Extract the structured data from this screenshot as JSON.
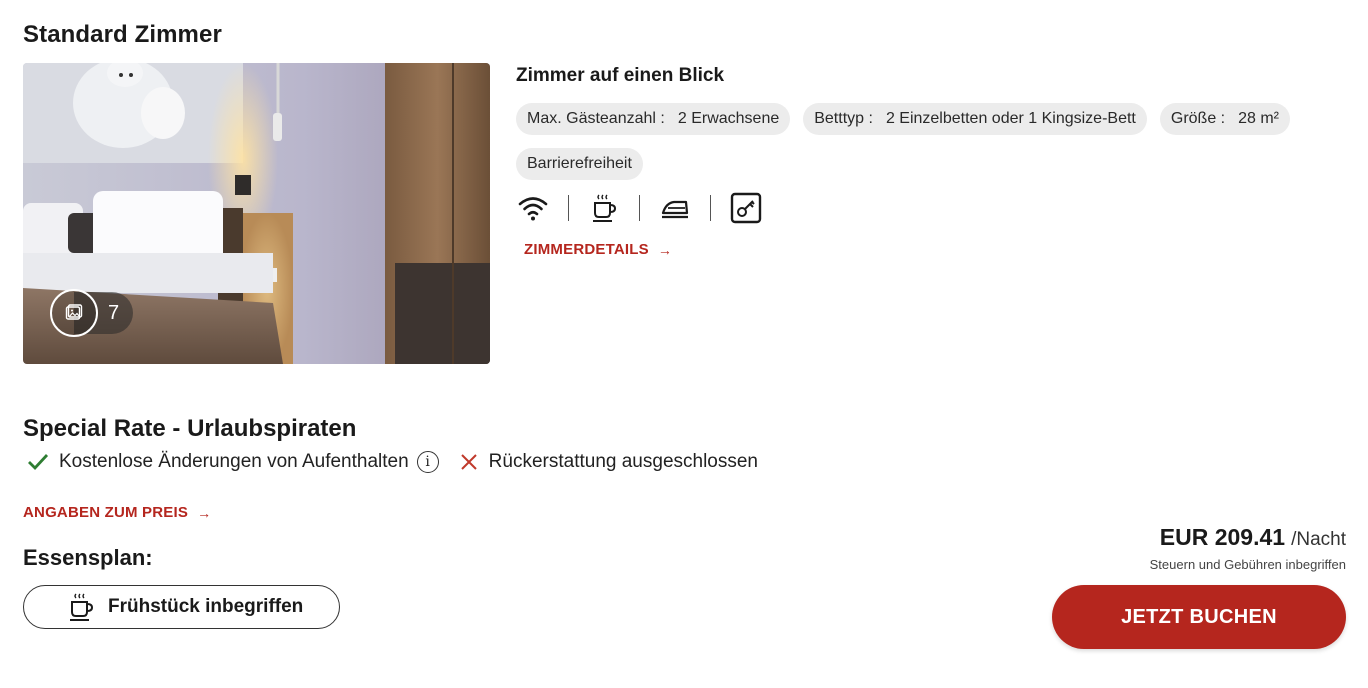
{
  "room": {
    "title": "Standard Zimmer",
    "gallery_count": "7",
    "glance_title": "Zimmer auf einen Blick",
    "chips": [
      {
        "label": "Max. Gästeanzahl :",
        "value": "2 Erwachsene"
      },
      {
        "label": "Betttyp :",
        "value": "2 Einzelbetten oder 1 Kingsize-Bett"
      },
      {
        "label": "Größe :",
        "value": "28 m²"
      },
      {
        "label": "Barrierefreiheit",
        "value": ""
      }
    ],
    "amenity_icons": [
      "wifi-icon",
      "coffee-icon",
      "iron-icon",
      "keycard-icon"
    ],
    "details_link": "ZIMMERDETAILS"
  },
  "rate": {
    "title": "Special Rate - Urlaubspiraten",
    "condition_yes": "Kostenlose Änderungen von Aufenthalten",
    "condition_no": "Rückerstattung ausgeschlossen",
    "price_link": "ANGABEN ZUM PREIS",
    "meal_title": "Essensplan:",
    "meal_value": "Frühstück inbegriffen",
    "price": "EUR 209.41",
    "per_night": "/Nacht",
    "tax_note": "Steuern und Gebühren inbegriffen",
    "book_button": "JETZT BUCHEN"
  },
  "colors": {
    "accent": "#b5261e",
    "check": "#2e7d32",
    "chip_bg": "#ececec"
  }
}
